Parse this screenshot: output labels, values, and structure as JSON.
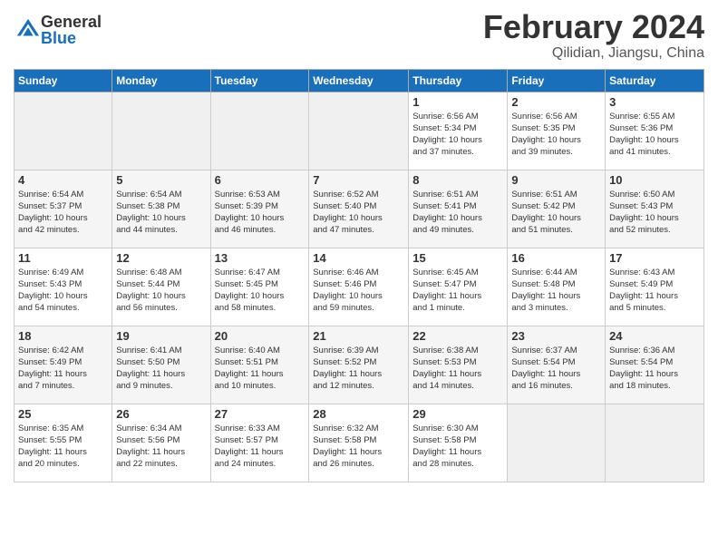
{
  "logo": {
    "general": "General",
    "blue": "Blue"
  },
  "title": "February 2024",
  "location": "Qilidian, Jiangsu, China",
  "days_of_week": [
    "Sunday",
    "Monday",
    "Tuesday",
    "Wednesday",
    "Thursday",
    "Friday",
    "Saturday"
  ],
  "weeks": [
    [
      {
        "day": "",
        "info": ""
      },
      {
        "day": "",
        "info": ""
      },
      {
        "day": "",
        "info": ""
      },
      {
        "day": "",
        "info": ""
      },
      {
        "day": "1",
        "info": "Sunrise: 6:56 AM\nSunset: 5:34 PM\nDaylight: 10 hours\nand 37 minutes."
      },
      {
        "day": "2",
        "info": "Sunrise: 6:56 AM\nSunset: 5:35 PM\nDaylight: 10 hours\nand 39 minutes."
      },
      {
        "day": "3",
        "info": "Sunrise: 6:55 AM\nSunset: 5:36 PM\nDaylight: 10 hours\nand 41 minutes."
      }
    ],
    [
      {
        "day": "4",
        "info": "Sunrise: 6:54 AM\nSunset: 5:37 PM\nDaylight: 10 hours\nand 42 minutes."
      },
      {
        "day": "5",
        "info": "Sunrise: 6:54 AM\nSunset: 5:38 PM\nDaylight: 10 hours\nand 44 minutes."
      },
      {
        "day": "6",
        "info": "Sunrise: 6:53 AM\nSunset: 5:39 PM\nDaylight: 10 hours\nand 46 minutes."
      },
      {
        "day": "7",
        "info": "Sunrise: 6:52 AM\nSunset: 5:40 PM\nDaylight: 10 hours\nand 47 minutes."
      },
      {
        "day": "8",
        "info": "Sunrise: 6:51 AM\nSunset: 5:41 PM\nDaylight: 10 hours\nand 49 minutes."
      },
      {
        "day": "9",
        "info": "Sunrise: 6:51 AM\nSunset: 5:42 PM\nDaylight: 10 hours\nand 51 minutes."
      },
      {
        "day": "10",
        "info": "Sunrise: 6:50 AM\nSunset: 5:43 PM\nDaylight: 10 hours\nand 52 minutes."
      }
    ],
    [
      {
        "day": "11",
        "info": "Sunrise: 6:49 AM\nSunset: 5:43 PM\nDaylight: 10 hours\nand 54 minutes."
      },
      {
        "day": "12",
        "info": "Sunrise: 6:48 AM\nSunset: 5:44 PM\nDaylight: 10 hours\nand 56 minutes."
      },
      {
        "day": "13",
        "info": "Sunrise: 6:47 AM\nSunset: 5:45 PM\nDaylight: 10 hours\nand 58 minutes."
      },
      {
        "day": "14",
        "info": "Sunrise: 6:46 AM\nSunset: 5:46 PM\nDaylight: 10 hours\nand 59 minutes."
      },
      {
        "day": "15",
        "info": "Sunrise: 6:45 AM\nSunset: 5:47 PM\nDaylight: 11 hours\nand 1 minute."
      },
      {
        "day": "16",
        "info": "Sunrise: 6:44 AM\nSunset: 5:48 PM\nDaylight: 11 hours\nand 3 minutes."
      },
      {
        "day": "17",
        "info": "Sunrise: 6:43 AM\nSunset: 5:49 PM\nDaylight: 11 hours\nand 5 minutes."
      }
    ],
    [
      {
        "day": "18",
        "info": "Sunrise: 6:42 AM\nSunset: 5:49 PM\nDaylight: 11 hours\nand 7 minutes."
      },
      {
        "day": "19",
        "info": "Sunrise: 6:41 AM\nSunset: 5:50 PM\nDaylight: 11 hours\nand 9 minutes."
      },
      {
        "day": "20",
        "info": "Sunrise: 6:40 AM\nSunset: 5:51 PM\nDaylight: 11 hours\nand 10 minutes."
      },
      {
        "day": "21",
        "info": "Sunrise: 6:39 AM\nSunset: 5:52 PM\nDaylight: 11 hours\nand 12 minutes."
      },
      {
        "day": "22",
        "info": "Sunrise: 6:38 AM\nSunset: 5:53 PM\nDaylight: 11 hours\nand 14 minutes."
      },
      {
        "day": "23",
        "info": "Sunrise: 6:37 AM\nSunset: 5:54 PM\nDaylight: 11 hours\nand 16 minutes."
      },
      {
        "day": "24",
        "info": "Sunrise: 6:36 AM\nSunset: 5:54 PM\nDaylight: 11 hours\nand 18 minutes."
      }
    ],
    [
      {
        "day": "25",
        "info": "Sunrise: 6:35 AM\nSunset: 5:55 PM\nDaylight: 11 hours\nand 20 minutes."
      },
      {
        "day": "26",
        "info": "Sunrise: 6:34 AM\nSunset: 5:56 PM\nDaylight: 11 hours\nand 22 minutes."
      },
      {
        "day": "27",
        "info": "Sunrise: 6:33 AM\nSunset: 5:57 PM\nDaylight: 11 hours\nand 24 minutes."
      },
      {
        "day": "28",
        "info": "Sunrise: 6:32 AM\nSunset: 5:58 PM\nDaylight: 11 hours\nand 26 minutes."
      },
      {
        "day": "29",
        "info": "Sunrise: 6:30 AM\nSunset: 5:58 PM\nDaylight: 11 hours\nand 28 minutes."
      },
      {
        "day": "",
        "info": ""
      },
      {
        "day": "",
        "info": ""
      }
    ]
  ]
}
